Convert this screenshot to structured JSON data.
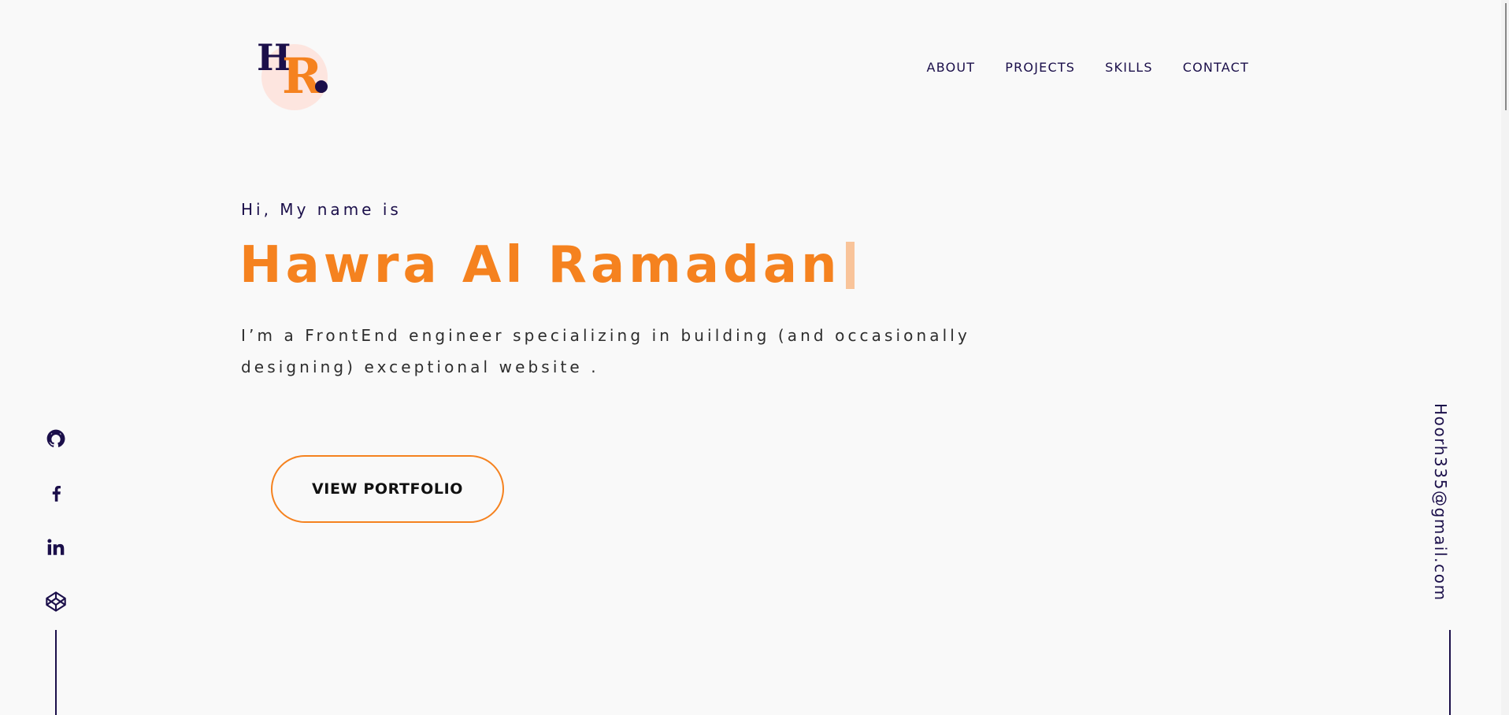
{
  "logo": {
    "letter_h": "H",
    "letter_r": "R",
    "colors": {
      "primary": "#1b0f4a",
      "accent": "#f5821f",
      "blob": "#fde5df"
    }
  },
  "nav": {
    "items": [
      {
        "label": "ABOUT"
      },
      {
        "label": "PROJECTS"
      },
      {
        "label": "SKILLS"
      },
      {
        "label": "CONTACT"
      }
    ]
  },
  "hero": {
    "greeting": "Hi, My name is",
    "name": "Hawra Al Ramadan",
    "intro": "I’m a FrontEnd engineer specializing in building (and occasionally designing) exceptional website .",
    "button_label": "VIEW PORTFOLIO"
  },
  "social": {
    "icons": [
      "github-icon",
      "facebook-icon",
      "linkedin-icon",
      "codepen-icon"
    ]
  },
  "email": "Hoorh335@gmail.com",
  "colors": {
    "accent": "#f5821f",
    "primary": "#1b0f4a",
    "background": "#f9f9f9"
  }
}
